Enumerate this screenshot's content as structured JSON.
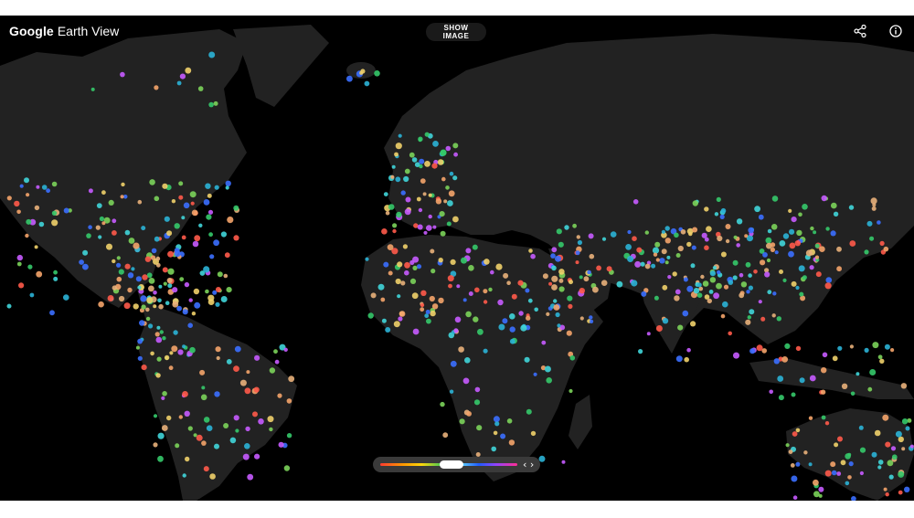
{
  "header": {
    "brand_google": "Google",
    "brand_product": "Earth View",
    "show_image_label": "SHOW IMAGE"
  },
  "icons": {
    "share": "share-icon",
    "info": "info-icon",
    "arrows": "left-right-arrows-icon"
  },
  "slider": {
    "position": 0.52,
    "arrows_text": "‹ ›"
  },
  "colors": {
    "background": "#000000",
    "land": "#222222",
    "text": "#ffffff",
    "dot_palette": [
      "#f4a46a",
      "#e8b07a",
      "#40d5d9",
      "#2bb3d6",
      "#35c96a",
      "#7bd35a",
      "#3b6fff",
      "#ff5a4a",
      "#c75bff",
      "#f0d06a"
    ]
  }
}
